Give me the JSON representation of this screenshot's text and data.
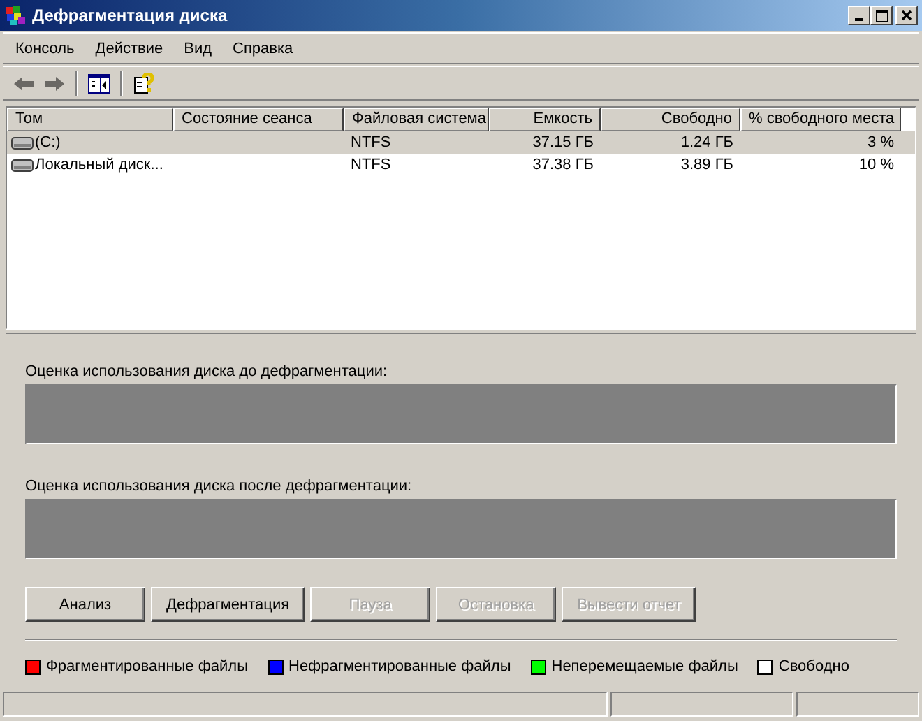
{
  "window": {
    "title": "Дефрагментация диска"
  },
  "menu": [
    "Консоль",
    "Действие",
    "Вид",
    "Справка"
  ],
  "toolbar": [
    {
      "kind": "back",
      "disabled": true
    },
    {
      "kind": "forward",
      "disabled": true
    },
    {
      "kind": "separator"
    },
    {
      "kind": "panel",
      "disabled": false
    },
    {
      "kind": "separator"
    },
    {
      "kind": "help",
      "disabled": false
    }
  ],
  "table": {
    "columns": [
      {
        "label": "Том"
      },
      {
        "label": "Состояние сеанса"
      },
      {
        "label": "Файловая система"
      },
      {
        "label": "Емкость"
      },
      {
        "label": "Свободно"
      },
      {
        "label": "% свободного места"
      }
    ],
    "rows": [
      {
        "selected": true,
        "cells": [
          "(C:)",
          "",
          "NTFS",
          "37.15 ГБ",
          "1.24 ГБ",
          "3 %"
        ]
      },
      {
        "selected": false,
        "cells": [
          "Локальный диск...",
          "",
          "NTFS",
          "37.38 ГБ",
          "3.89 ГБ",
          "10 %"
        ]
      }
    ]
  },
  "before_label": "Оценка использования диска до дефрагментации:",
  "after_label": "Оценка использования диска после дефрагментации:",
  "buttons": [
    {
      "label": "Анализ",
      "disabled": false
    },
    {
      "label": "Дефрагментация",
      "disabled": false
    },
    {
      "label": "Пауза",
      "disabled": true
    },
    {
      "label": "Остановка",
      "disabled": true
    },
    {
      "label": "Вывести отчет",
      "disabled": true
    }
  ],
  "legend": [
    {
      "label": "Фрагментированные файлы",
      "color": "#ff0000"
    },
    {
      "label": "Нефрагментированные файлы",
      "color": "#0000ff"
    },
    {
      "label": "Неперемещаемые файлы",
      "color": "#00ff00"
    },
    {
      "label": "Свободно",
      "color": "#ffffff"
    }
  ]
}
